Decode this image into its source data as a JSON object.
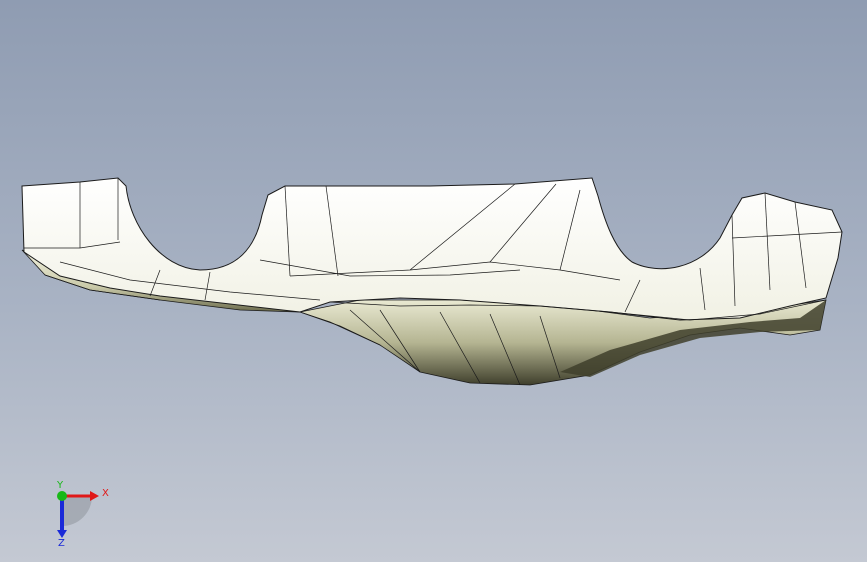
{
  "viewport": {
    "background_top": "#8f9cb2",
    "background_bottom": "#c4c9d3"
  },
  "model": {
    "icon": "3d-part-model",
    "surface_color": "#f4f4e6",
    "shadow_color": "#3f3f2c",
    "edge_color": "#1b1b1b",
    "display_mode": "shaded-with-edges"
  },
  "triad": {
    "x_label": "X",
    "y_label": "Y",
    "z_label": "Z",
    "x_color": "#e01818",
    "y_color": "#18b818",
    "z_color": "#1a2ad8"
  }
}
